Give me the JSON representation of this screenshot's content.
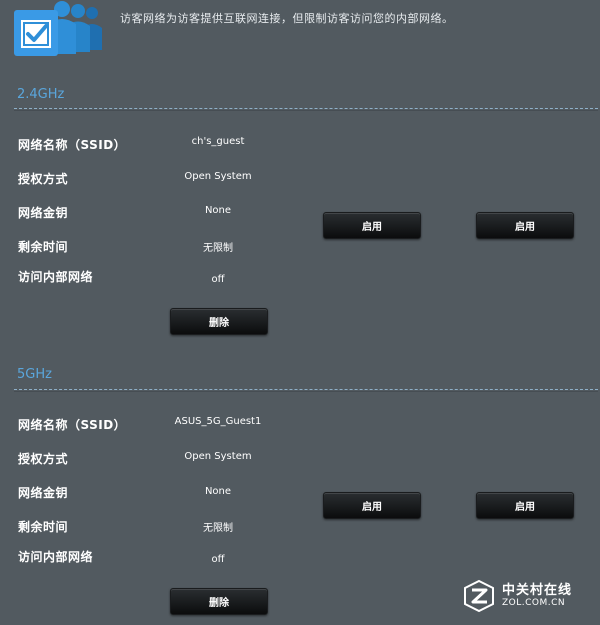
{
  "header": {
    "description": "访客网络为访客提供互联网连接，但限制访客访问您的内部网络。",
    "icon": "guest-network-users-icon",
    "icon_color": "#2f8fd8"
  },
  "bands": [
    {
      "title": "2.4GHz",
      "rows": [
        {
          "label": "网络名称（SSID）",
          "value": "ch's_guest"
        },
        {
          "label": "授权方式",
          "value": "Open System"
        },
        {
          "label": "网络金钥",
          "value": "None"
        },
        {
          "label": "剩余时间",
          "value": "无限制"
        },
        {
          "label": "访问内部网络",
          "value": "off"
        }
      ],
      "remove_label": "删除",
      "enable_labels": [
        "启用",
        "启用"
      ]
    },
    {
      "title": "5GHz",
      "rows": [
        {
          "label": "网络名称（SSID）",
          "value": "ASUS_5G_Guest1"
        },
        {
          "label": "授权方式",
          "value": "Open System"
        },
        {
          "label": "网络金钥",
          "value": "None"
        },
        {
          "label": "剩余时间",
          "value": "无限制"
        },
        {
          "label": "访问内部网络",
          "value": "off"
        }
      ],
      "remove_label": "删除",
      "enable_labels": [
        "启用",
        "启用"
      ]
    }
  ],
  "watermark": {
    "cn": "中关村在线",
    "en": "ZOL.COM.CN"
  },
  "colors": {
    "background": "#525a60",
    "band_title": "#5aa6dc",
    "button": "#111315"
  }
}
